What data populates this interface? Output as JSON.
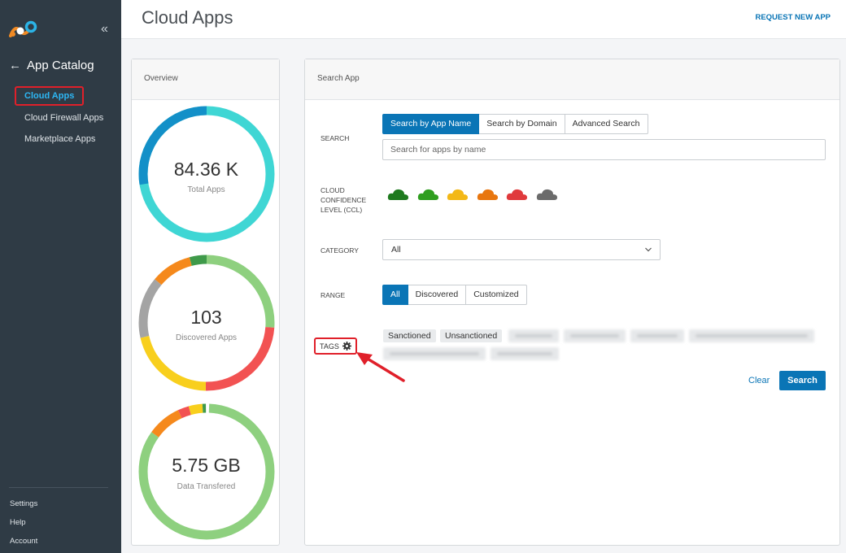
{
  "sidebar": {
    "back_label": "App Catalog",
    "items": [
      {
        "label": "Cloud Apps",
        "active": true
      },
      {
        "label": "Cloud Firewall Apps"
      },
      {
        "label": "Marketplace Apps"
      }
    ],
    "bottom": [
      {
        "label": "Settings"
      },
      {
        "label": "Help"
      },
      {
        "label": "Account"
      }
    ]
  },
  "header": {
    "title": "Cloud Apps",
    "request_link": "REQUEST NEW APP"
  },
  "overview": {
    "title": "Overview",
    "total_apps": {
      "value": "84.36 K",
      "label": "Total Apps"
    },
    "discovered_apps": {
      "value": "103",
      "label": "Discovered Apps"
    },
    "data_transfered": {
      "value": "5.75 GB",
      "label": "Data Transfered"
    }
  },
  "search_panel": {
    "title": "Search App",
    "search_label": "SEARCH",
    "search_modes": [
      "Search by App Name",
      "Search by Domain",
      "Advanced Search"
    ],
    "search_placeholder": "Search for apps by name",
    "ccl_label_lines": [
      "CLOUD",
      "CONFIDENCE",
      "LEVEL (CCL)"
    ],
    "ccl_colors": [
      "#1e7a1e",
      "#2f9e1f",
      "#f3b817",
      "#e8760f",
      "#e03a3c",
      "#6b6b6b"
    ],
    "category_label": "CATEGORY",
    "category_value": "All",
    "range_label": "RANGE",
    "range_options": [
      "All",
      "Discovered",
      "Customized"
    ],
    "tags_label": "TAGS",
    "tags": [
      "Sanctioned",
      "Unsanctioned"
    ],
    "clear_label": "Clear",
    "search_button": "Search"
  },
  "colors": {
    "sidebar_bg": "#2f3b45",
    "accent": "#0a75b6",
    "annotation": "#e0202a"
  }
}
